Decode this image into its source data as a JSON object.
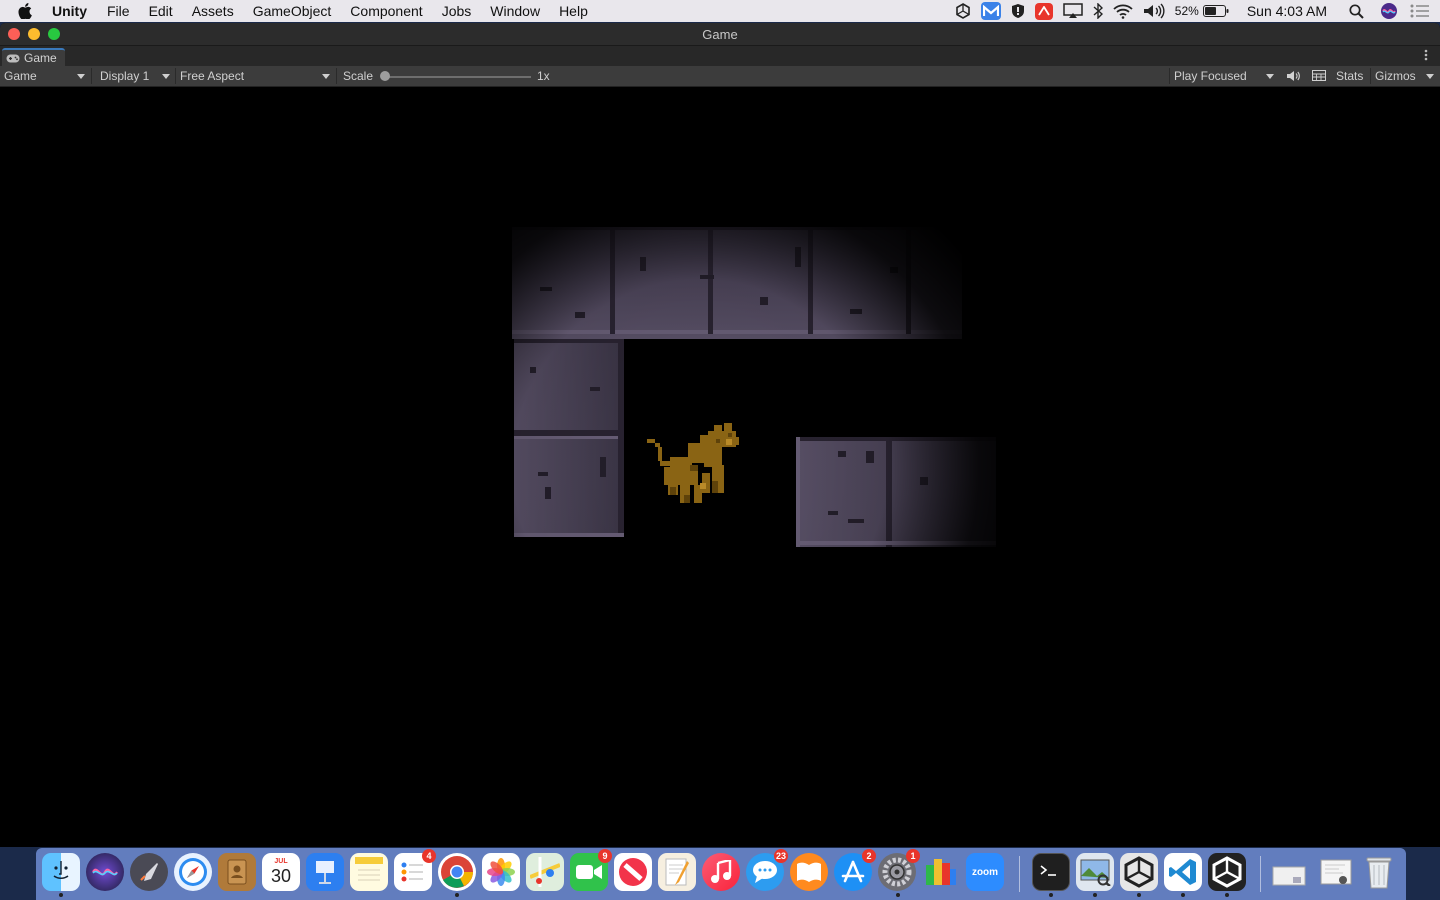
{
  "menubar": {
    "app_name": "Unity",
    "items": [
      "File",
      "Edit",
      "Assets",
      "GameObject",
      "Component",
      "Jobs",
      "Window",
      "Help"
    ],
    "battery_percent": "52%",
    "clock": "Sun 4:03 AM"
  },
  "window": {
    "title": "Game",
    "tab_label": "Game"
  },
  "toolbar": {
    "view_select": "Game",
    "display_select": "Display 1",
    "aspect_select": "Free Aspect",
    "scale_label": "Scale",
    "scale_value": "1x",
    "scale_fraction": 0.0,
    "play_mode_select": "Play Focused",
    "stats_label": "Stats",
    "gizmos_label": "Gizmos"
  },
  "dock": {
    "calendar_month": "JUL",
    "calendar_day": "30",
    "zoom_label": "zoom",
    "badges": {
      "reminders": "4",
      "facetime": "9",
      "messages": "23",
      "app_store": "2",
      "system_preferences": "1"
    }
  },
  "colors": {
    "wall_light": "#5a5168",
    "wall_dark": "#2d2836",
    "wall_line": "#1c1822",
    "cat": "#8a6414",
    "cat_dark": "#5e420a",
    "editor_dark": "#3c3c3c",
    "accent_blue": "#3a79bb"
  }
}
